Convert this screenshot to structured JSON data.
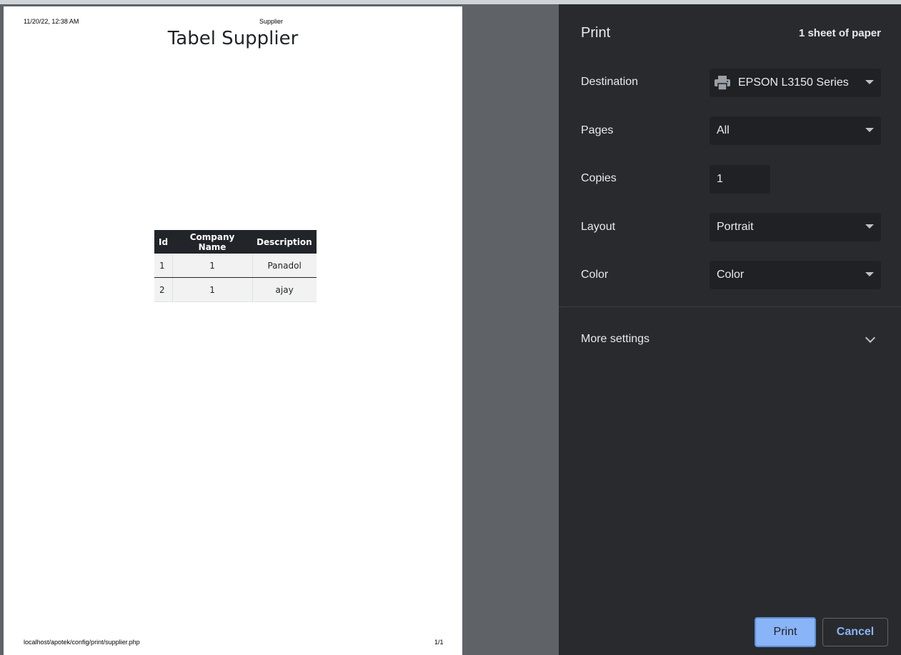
{
  "preview": {
    "header_date": "11/20/22, 12:38 AM",
    "header_title": "Supplier",
    "doc_title": "Tabel Supplier",
    "table": {
      "headers": [
        "Id",
        "Company Name",
        "Description"
      ],
      "rows": [
        [
          "1",
          "1",
          "Panadol"
        ],
        [
          "2",
          "1",
          "ajay"
        ]
      ]
    },
    "footer_url": "localhost/apotek/config/print/supplier.php",
    "footer_page": "1/1"
  },
  "print_panel": {
    "title": "Print",
    "sheet_count": "1 sheet of paper",
    "destination": {
      "label": "Destination",
      "value": "EPSON L3150 Series",
      "icon": "printer-icon"
    },
    "pages": {
      "label": "Pages",
      "value": "All"
    },
    "copies": {
      "label": "Copies",
      "value": "1"
    },
    "layout": {
      "label": "Layout",
      "value": "Portrait"
    },
    "color": {
      "label": "Color",
      "value": "Color"
    },
    "more_settings": "More settings",
    "print_button": "Print",
    "cancel_button": "Cancel"
  }
}
